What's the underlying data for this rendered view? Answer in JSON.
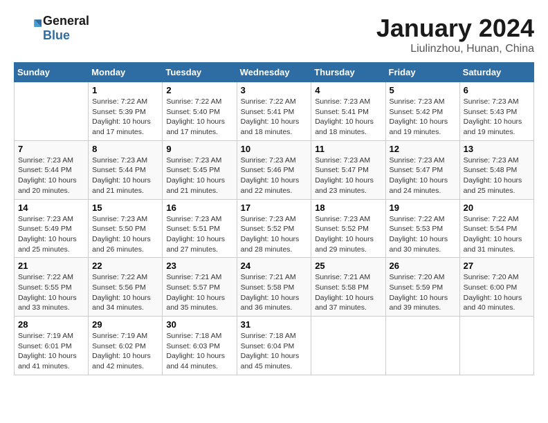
{
  "logo": {
    "line1": "General",
    "line2": "Blue"
  },
  "title": "January 2024",
  "subtitle": "Liulinzhou, Hunan, China",
  "weekdays": [
    "Sunday",
    "Monday",
    "Tuesday",
    "Wednesday",
    "Thursday",
    "Friday",
    "Saturday"
  ],
  "weeks": [
    [
      {
        "day": "",
        "sunrise": "",
        "sunset": "",
        "daylight": ""
      },
      {
        "day": "1",
        "sunrise": "Sunrise: 7:22 AM",
        "sunset": "Sunset: 5:39 PM",
        "daylight": "Daylight: 10 hours and 17 minutes."
      },
      {
        "day": "2",
        "sunrise": "Sunrise: 7:22 AM",
        "sunset": "Sunset: 5:40 PM",
        "daylight": "Daylight: 10 hours and 17 minutes."
      },
      {
        "day": "3",
        "sunrise": "Sunrise: 7:22 AM",
        "sunset": "Sunset: 5:41 PM",
        "daylight": "Daylight: 10 hours and 18 minutes."
      },
      {
        "day": "4",
        "sunrise": "Sunrise: 7:23 AM",
        "sunset": "Sunset: 5:41 PM",
        "daylight": "Daylight: 10 hours and 18 minutes."
      },
      {
        "day": "5",
        "sunrise": "Sunrise: 7:23 AM",
        "sunset": "Sunset: 5:42 PM",
        "daylight": "Daylight: 10 hours and 19 minutes."
      },
      {
        "day": "6",
        "sunrise": "Sunrise: 7:23 AM",
        "sunset": "Sunset: 5:43 PM",
        "daylight": "Daylight: 10 hours and 19 minutes."
      }
    ],
    [
      {
        "day": "7",
        "sunrise": "Sunrise: 7:23 AM",
        "sunset": "Sunset: 5:44 PM",
        "daylight": "Daylight: 10 hours and 20 minutes."
      },
      {
        "day": "8",
        "sunrise": "Sunrise: 7:23 AM",
        "sunset": "Sunset: 5:44 PM",
        "daylight": "Daylight: 10 hours and 21 minutes."
      },
      {
        "day": "9",
        "sunrise": "Sunrise: 7:23 AM",
        "sunset": "Sunset: 5:45 PM",
        "daylight": "Daylight: 10 hours and 21 minutes."
      },
      {
        "day": "10",
        "sunrise": "Sunrise: 7:23 AM",
        "sunset": "Sunset: 5:46 PM",
        "daylight": "Daylight: 10 hours and 22 minutes."
      },
      {
        "day": "11",
        "sunrise": "Sunrise: 7:23 AM",
        "sunset": "Sunset: 5:47 PM",
        "daylight": "Daylight: 10 hours and 23 minutes."
      },
      {
        "day": "12",
        "sunrise": "Sunrise: 7:23 AM",
        "sunset": "Sunset: 5:47 PM",
        "daylight": "Daylight: 10 hours and 24 minutes."
      },
      {
        "day": "13",
        "sunrise": "Sunrise: 7:23 AM",
        "sunset": "Sunset: 5:48 PM",
        "daylight": "Daylight: 10 hours and 25 minutes."
      }
    ],
    [
      {
        "day": "14",
        "sunrise": "Sunrise: 7:23 AM",
        "sunset": "Sunset: 5:49 PM",
        "daylight": "Daylight: 10 hours and 25 minutes."
      },
      {
        "day": "15",
        "sunrise": "Sunrise: 7:23 AM",
        "sunset": "Sunset: 5:50 PM",
        "daylight": "Daylight: 10 hours and 26 minutes."
      },
      {
        "day": "16",
        "sunrise": "Sunrise: 7:23 AM",
        "sunset": "Sunset: 5:51 PM",
        "daylight": "Daylight: 10 hours and 27 minutes."
      },
      {
        "day": "17",
        "sunrise": "Sunrise: 7:23 AM",
        "sunset": "Sunset: 5:52 PM",
        "daylight": "Daylight: 10 hours and 28 minutes."
      },
      {
        "day": "18",
        "sunrise": "Sunrise: 7:23 AM",
        "sunset": "Sunset: 5:52 PM",
        "daylight": "Daylight: 10 hours and 29 minutes."
      },
      {
        "day": "19",
        "sunrise": "Sunrise: 7:22 AM",
        "sunset": "Sunset: 5:53 PM",
        "daylight": "Daylight: 10 hours and 30 minutes."
      },
      {
        "day": "20",
        "sunrise": "Sunrise: 7:22 AM",
        "sunset": "Sunset: 5:54 PM",
        "daylight": "Daylight: 10 hours and 31 minutes."
      }
    ],
    [
      {
        "day": "21",
        "sunrise": "Sunrise: 7:22 AM",
        "sunset": "Sunset: 5:55 PM",
        "daylight": "Daylight: 10 hours and 33 minutes."
      },
      {
        "day": "22",
        "sunrise": "Sunrise: 7:22 AM",
        "sunset": "Sunset: 5:56 PM",
        "daylight": "Daylight: 10 hours and 34 minutes."
      },
      {
        "day": "23",
        "sunrise": "Sunrise: 7:21 AM",
        "sunset": "Sunset: 5:57 PM",
        "daylight": "Daylight: 10 hours and 35 minutes."
      },
      {
        "day": "24",
        "sunrise": "Sunrise: 7:21 AM",
        "sunset": "Sunset: 5:58 PM",
        "daylight": "Daylight: 10 hours and 36 minutes."
      },
      {
        "day": "25",
        "sunrise": "Sunrise: 7:21 AM",
        "sunset": "Sunset: 5:58 PM",
        "daylight": "Daylight: 10 hours and 37 minutes."
      },
      {
        "day": "26",
        "sunrise": "Sunrise: 7:20 AM",
        "sunset": "Sunset: 5:59 PM",
        "daylight": "Daylight: 10 hours and 39 minutes."
      },
      {
        "day": "27",
        "sunrise": "Sunrise: 7:20 AM",
        "sunset": "Sunset: 6:00 PM",
        "daylight": "Daylight: 10 hours and 40 minutes."
      }
    ],
    [
      {
        "day": "28",
        "sunrise": "Sunrise: 7:19 AM",
        "sunset": "Sunset: 6:01 PM",
        "daylight": "Daylight: 10 hours and 41 minutes."
      },
      {
        "day": "29",
        "sunrise": "Sunrise: 7:19 AM",
        "sunset": "Sunset: 6:02 PM",
        "daylight": "Daylight: 10 hours and 42 minutes."
      },
      {
        "day": "30",
        "sunrise": "Sunrise: 7:18 AM",
        "sunset": "Sunset: 6:03 PM",
        "daylight": "Daylight: 10 hours and 44 minutes."
      },
      {
        "day": "31",
        "sunrise": "Sunrise: 7:18 AM",
        "sunset": "Sunset: 6:04 PM",
        "daylight": "Daylight: 10 hours and 45 minutes."
      },
      {
        "day": "",
        "sunrise": "",
        "sunset": "",
        "daylight": ""
      },
      {
        "day": "",
        "sunrise": "",
        "sunset": "",
        "daylight": ""
      },
      {
        "day": "",
        "sunrise": "",
        "sunset": "",
        "daylight": ""
      }
    ]
  ]
}
